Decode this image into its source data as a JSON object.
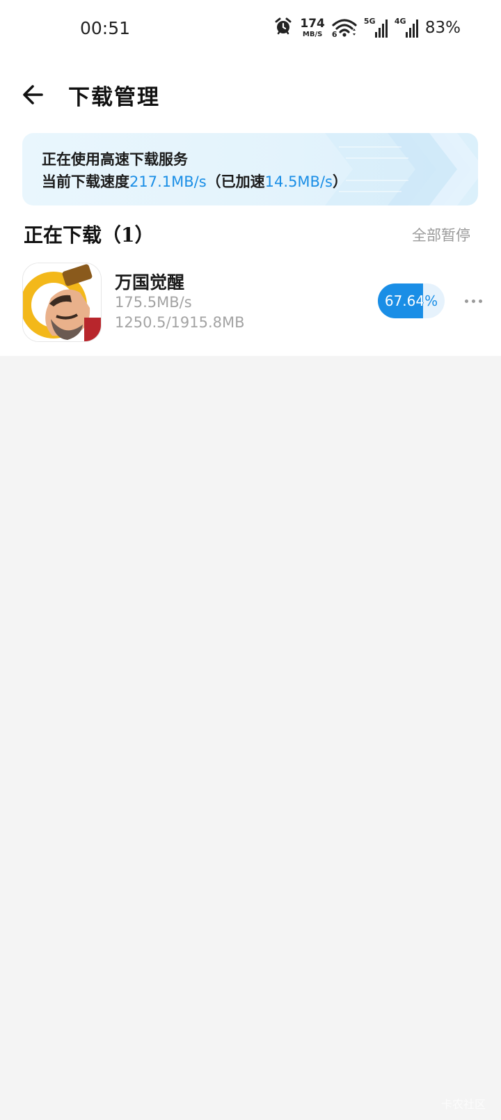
{
  "status_bar": {
    "time": "00:51",
    "net_speed_value": "174",
    "net_speed_unit": "MB/S",
    "wifi_label": "6",
    "signal_1_label": "5G",
    "signal_2_label": "4G",
    "battery": "83%",
    "icons": [
      "alarm-icon",
      "wifi-icon",
      "signal-icon"
    ]
  },
  "header": {
    "title": "下载管理",
    "back_icon": "arrow-left-icon"
  },
  "banner": {
    "line1": "正在使用高速下载服务",
    "speed_prefix": "当前下载速度",
    "current_speed": "217.1MB/s",
    "boost_prefix": "（已加速",
    "boost_speed": "14.5MB/s",
    "boost_suffix": "）"
  },
  "section": {
    "title": "正在下载（1）",
    "pause_all_label": "全部暂停"
  },
  "downloads": [
    {
      "name": "万国觉醒",
      "speed": "175.5MB/s",
      "size": "1250.5/1915.8MB",
      "progress_label": "67.64%",
      "progress_fraction": 0.6764
    }
  ],
  "watermark": "卡农社区",
  "colors": {
    "accent": "#1a8ee6",
    "page_background": "#f4f4f4",
    "card_background": "#ffffff",
    "secondary_text": "#a3a3a3"
  }
}
